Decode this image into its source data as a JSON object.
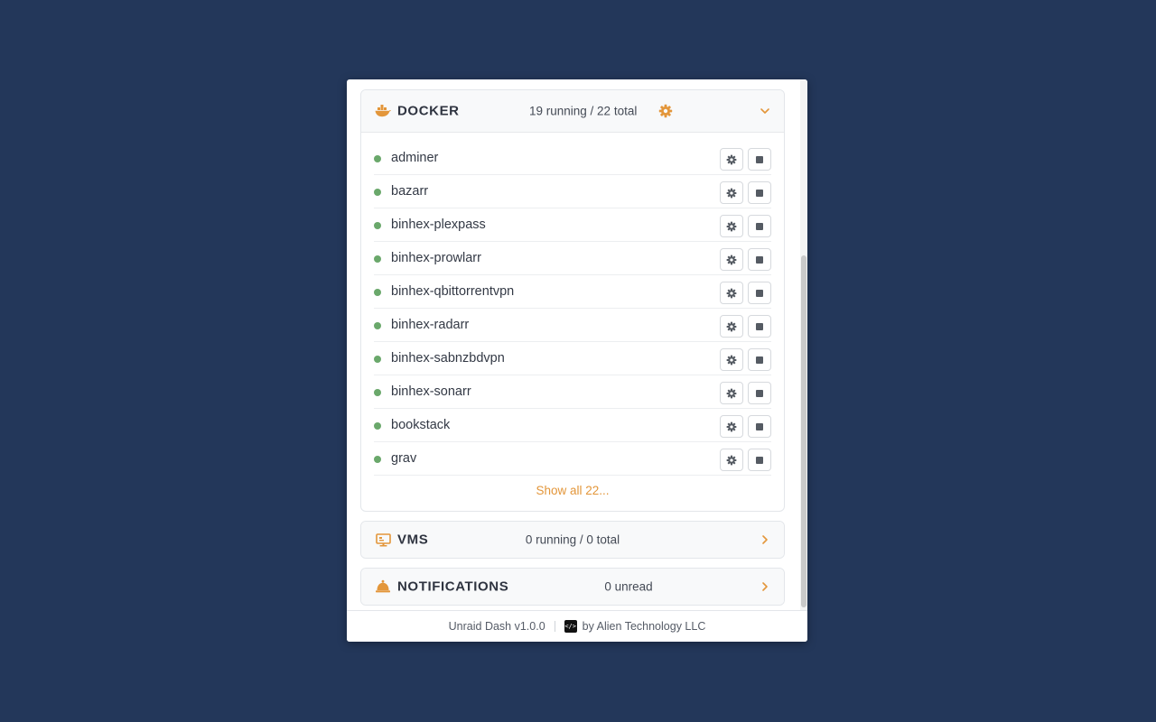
{
  "colors": {
    "background": "#23375a",
    "accent": "#e3963a",
    "running": "#6aa86b"
  },
  "docker": {
    "title": "DOCKER",
    "count": "19 running / 22 total",
    "icon": "docker-whale-icon",
    "expanded": true,
    "containers": [
      {
        "name": "adminer",
        "status": "running"
      },
      {
        "name": "bazarr",
        "status": "running"
      },
      {
        "name": "binhex-plexpass",
        "status": "running"
      },
      {
        "name": "binhex-prowlarr",
        "status": "running"
      },
      {
        "name": "binhex-qbittorrentvpn",
        "status": "running"
      },
      {
        "name": "binhex-radarr",
        "status": "running"
      },
      {
        "name": "binhex-sabnzbdvpn",
        "status": "running"
      },
      {
        "name": "binhex-sonarr",
        "status": "running"
      },
      {
        "name": "bookstack",
        "status": "running"
      },
      {
        "name": "grav",
        "status": "running"
      }
    ],
    "show_all": "Show all 22..."
  },
  "vms": {
    "title": "VMS",
    "count": "0 running / 0 total",
    "icon": "monitor-icon"
  },
  "notifications": {
    "title": "NOTIFICATIONS",
    "count": "0 unread",
    "icon": "bell-icon"
  },
  "footer": {
    "version": "Unraid Dash v1.0.0",
    "author": "by Alien Technology LLC",
    "logo_text": "</>"
  }
}
